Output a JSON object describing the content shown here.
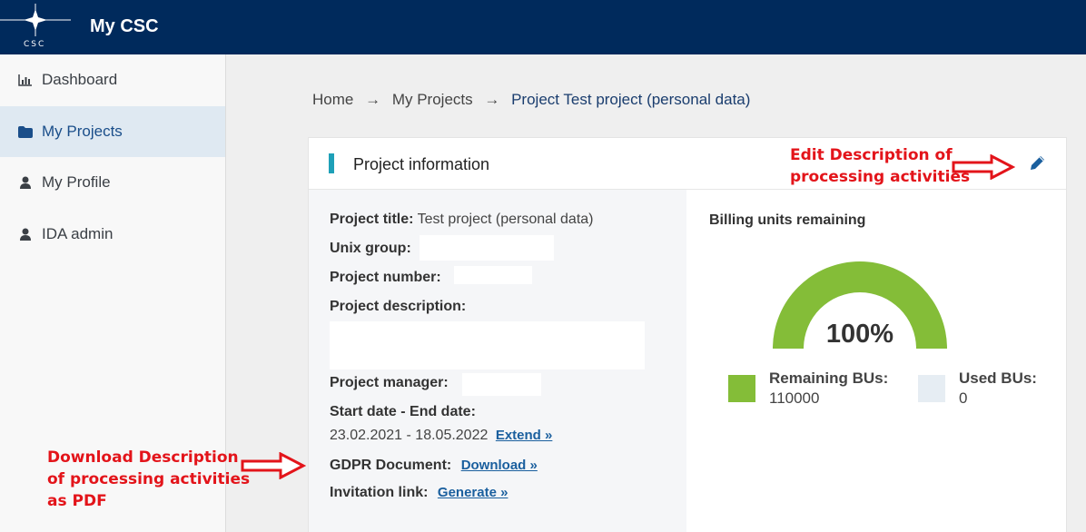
{
  "header": {
    "logo_text": "CSC",
    "app_title": "My CSC",
    "colors": {
      "bar": "#002a5c"
    }
  },
  "sidebar": {
    "items": [
      {
        "label": "Dashboard",
        "icon": "bar-chart-icon",
        "active": false
      },
      {
        "label": "My Projects",
        "icon": "folder-icon",
        "active": true
      },
      {
        "label": "My Profile",
        "icon": "user-icon",
        "active": false
      },
      {
        "label": "IDA admin",
        "icon": "user-icon",
        "active": false
      }
    ]
  },
  "breadcrumb": {
    "items": [
      "Home",
      "My Projects",
      "Project Test project (personal data)"
    ],
    "separator": "→"
  },
  "card": {
    "title": "Project information",
    "edit_icon": "pencil-icon",
    "info": {
      "project_title_label": "Project title:",
      "project_title_value": "Test project (personal data)",
      "unix_group_label": "Unix group:",
      "project_number_label": "Project number:",
      "project_description_label": "Project description:",
      "project_manager_label": "Project manager:",
      "dates_label": "Start date - End date:",
      "dates_value": "23.02.2021 - 18.05.2022",
      "extend_link": "Extend »",
      "gdpr_label": "GDPR Document:",
      "download_link": "Download »",
      "invitation_label": "Invitation link:",
      "generate_link": "Generate »"
    },
    "billing": {
      "title": "Billing units remaining",
      "percent": "100%",
      "remaining_fraction": 1.0,
      "remaining_label": "Remaining BUs:",
      "remaining_value": "110000",
      "used_label": "Used BUs:",
      "used_value": "0",
      "colors": {
        "remaining": "#84bd38",
        "used": "#e6edf3"
      }
    }
  },
  "annotations": {
    "edit_note_line1": "Edit Description of",
    "edit_note_line2": "processing activities",
    "download_note_line1": "Download Description",
    "download_note_line2": "of processing activities",
    "download_note_line3": "as PDF",
    "color": "#e3141a"
  }
}
